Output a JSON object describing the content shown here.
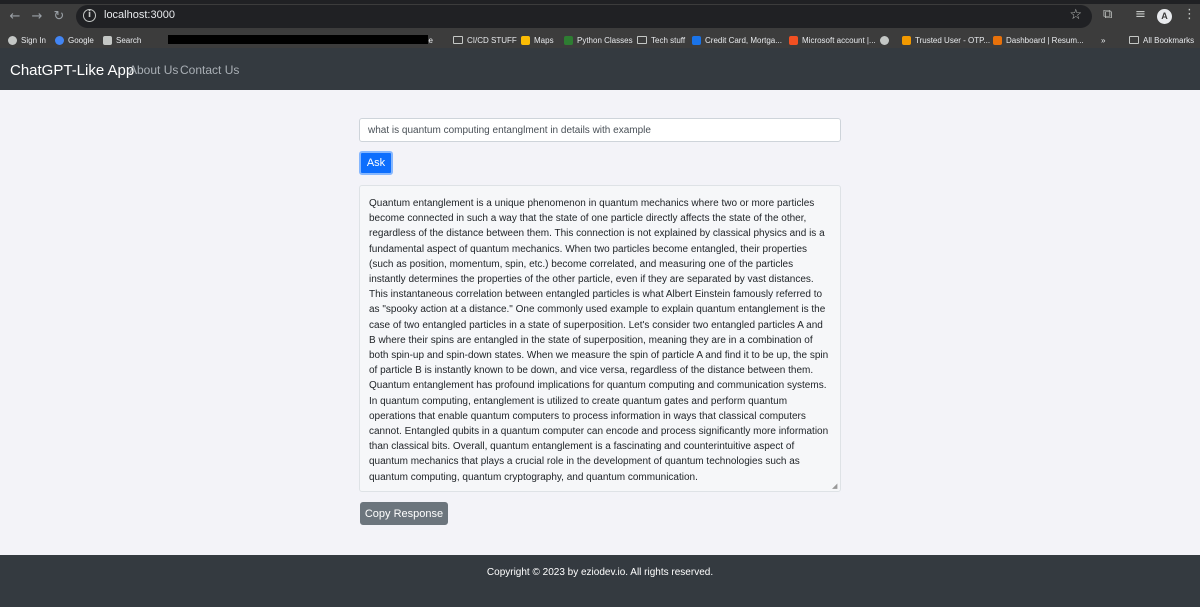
{
  "browser": {
    "url": "localhost:3000",
    "bookmarks": [
      {
        "label": "Sign In",
        "color": "#c4c7c5",
        "kind": "globe"
      },
      {
        "label": "Google",
        "color": "#4285f4",
        "kind": "globe"
      },
      {
        "label": "Search",
        "color": "#c4c7c5",
        "kind": "box"
      },
      {
        "label": "be",
        "color": "#3c3c3c",
        "kind": "none"
      },
      {
        "label": "CI/CD STUFF",
        "color": "#c4c7c5",
        "kind": "folder"
      },
      {
        "label": "Maps",
        "color": "#fbbc04",
        "kind": "box"
      },
      {
        "label": "Python Classes",
        "color": "#2e7d32",
        "kind": "box"
      },
      {
        "label": "Tech stuff",
        "color": "#c4c7c5",
        "kind": "folder"
      },
      {
        "label": "Credit Card, Mortga...",
        "color": "#1a73e8",
        "kind": "box"
      },
      {
        "label": "Microsoft account |...",
        "color": "#f25022",
        "kind": "box"
      },
      {
        "label": "",
        "color": "#c4c7c5",
        "kind": "globe"
      },
      {
        "label": "Trusted User - OTP...",
        "color": "#f29900",
        "kind": "box"
      },
      {
        "label": "Dashboard | Resum...",
        "color": "#e8710a",
        "kind": "box"
      },
      {
        "label": "»",
        "color": "#3c3c3c",
        "kind": "none"
      },
      {
        "label": "All Bookmarks",
        "color": "#c4c7c5",
        "kind": "folder"
      }
    ]
  },
  "navbar": {
    "brand": "ChatGPT-Like App",
    "links": [
      "About Us",
      "Contact Us"
    ]
  },
  "main": {
    "query_value": "what is quantum computing entanglment in details with example",
    "ask_label": "Ask",
    "response_text": "Quantum entanglement is a unique phenomenon in quantum mechanics where two or more particles become connected in such a way that the state of one particle directly affects the state of the other, regardless of the distance between them. This connection is not explained by classical physics and is a fundamental aspect of quantum mechanics. When two particles become entangled, their properties (such as position, momentum, spin, etc.) become correlated, and measuring one of the particles instantly determines the properties of the other particle, even if they are separated by vast distances. This instantaneous correlation between entangled particles is what Albert Einstein famously referred to as \"spooky action at a distance.\" One commonly used example to explain quantum entanglement is the case of two entangled particles in a state of superposition. Let's consider two entangled particles A and B where their spins are entangled in the state of superposition, meaning they are in a combination of both spin-up and spin-down states. When we measure the spin of particle A and find it to be up, the spin of particle B is instantly known to be down, and vice versa, regardless of the distance between them. Quantum entanglement has profound implications for quantum computing and communication systems. In quantum computing, entanglement is utilized to create quantum gates and perform quantum operations that enable quantum computers to process information in ways that classical computers cannot. Entangled qubits in a quantum computer can encode and process significantly more information than classical bits. Overall, quantum entanglement is a fascinating and counterintuitive aspect of quantum mechanics that plays a crucial role in the development of quantum technologies such as quantum computing, quantum cryptography, and quantum communication.",
    "copy_label": "Copy Response"
  },
  "footer": {
    "text": "Copyright © 2023 by eziodev.io. All rights reserved."
  }
}
